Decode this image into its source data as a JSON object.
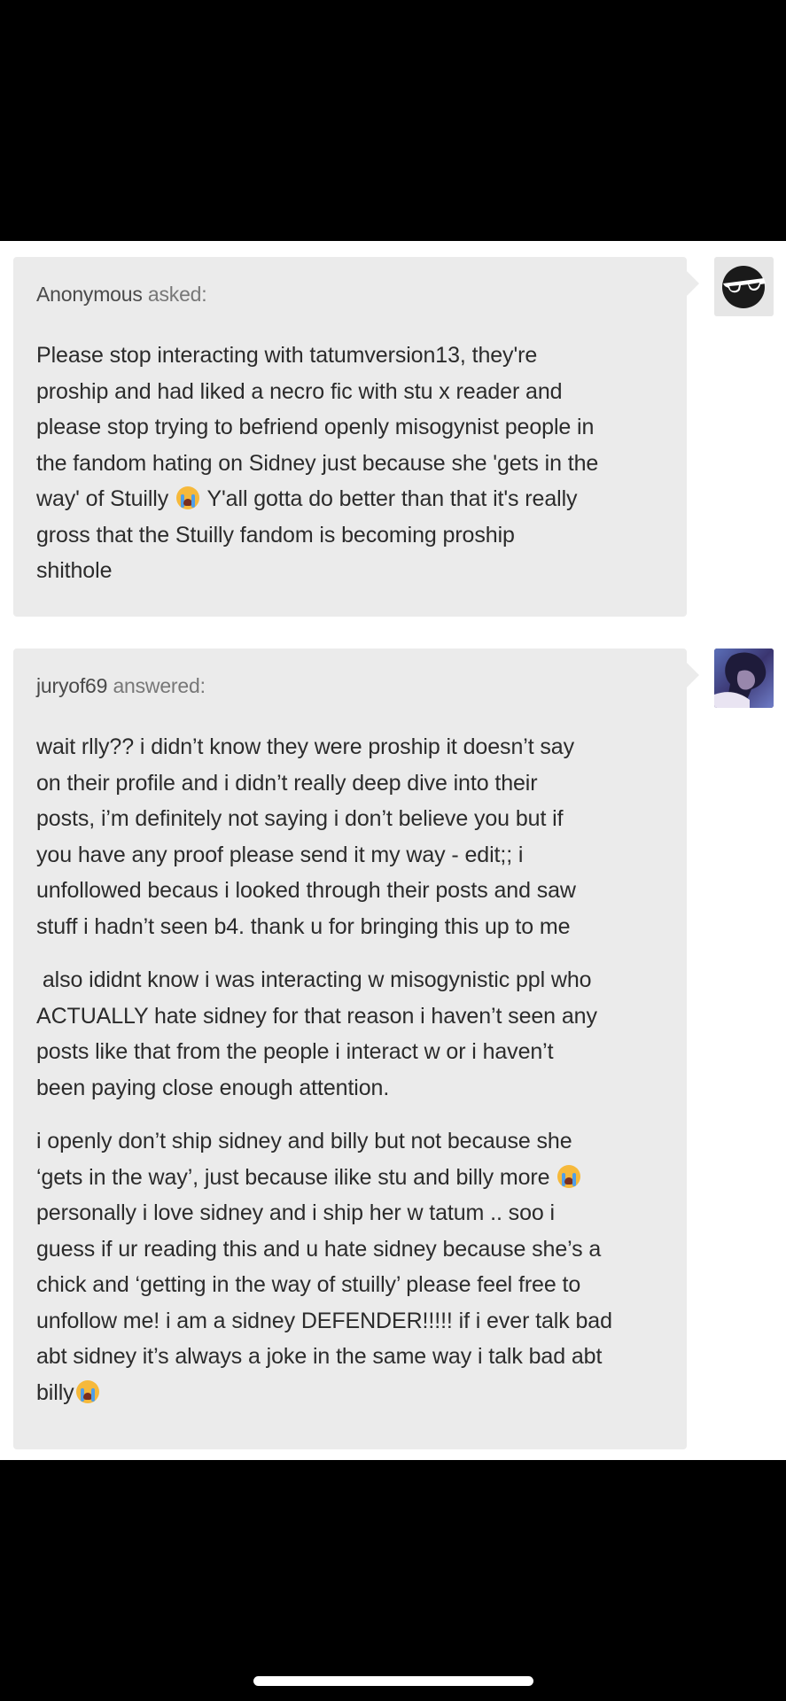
{
  "ask": {
    "asker_name": "Anonymous",
    "asker_verb": "asked:",
    "lines": [
      "Please stop interacting with tatumversion13, they're",
      "proship and had liked a necro fic with stu x reader and",
      "please stop trying to befriend openly misogynist people in",
      "the fandom hating on Sidney just because she 'gets in the",
      "way' of Stuilly",
      "Y'all gotta do better than that it's really",
      "gross that the Stuilly fandom is becoming proship",
      "shithole"
    ],
    "avatar_icon": "sunglasses-icon"
  },
  "answer": {
    "answerer_name": "juryof69",
    "answerer_verb": "answered:",
    "para1": [
      "wait rlly?? i didn’t know they were proship it doesn’t say",
      "on their profile and i didn’t really deep dive into their",
      "posts, i’m definitely not saying i don’t believe you but if",
      "you have any proof please send it my way - edit;; i",
      "unfollowed becaus i looked through their posts and saw",
      "stuff i hadn’t seen b4. thank u for bringing this up to me"
    ],
    "para2": [
      " also ididnt know i was interacting w misogynistic ppl who",
      "ACTUALLY hate sidney for that reason i haven’t seen any",
      "posts like that from the people i interact w or i haven’t",
      "been paying close enough attention."
    ],
    "para3": [
      "i openly don’t ship sidney and billy but not because she",
      "‘gets in the way’, just because ilike stu and billy more",
      "personally i love sidney and i ship her w tatum .. soo i",
      "guess if ur reading this and u hate sidney because she’s a",
      "chick and ‘getting in the way of stuilly’ please feel free to",
      "unfollow me! i am a sidney DEFENDER!!!!! if i ever talk bad",
      "abt sidney it’s always a joke in the same way i talk bad abt",
      "billy"
    ]
  },
  "colors": {
    "bubble": "#ebebeb",
    "text": "#2b2b2b",
    "emoji": "loudly-crying-face-icon"
  }
}
